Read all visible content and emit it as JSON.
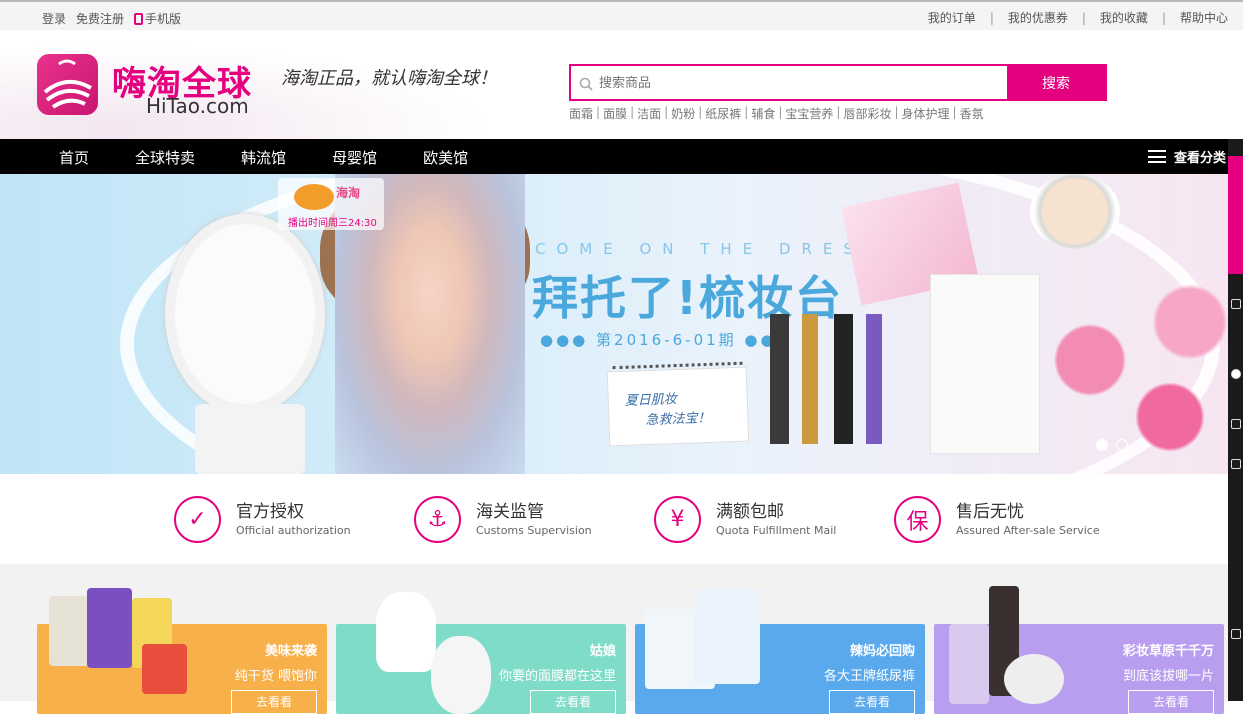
{
  "topbar": {
    "login": "登录",
    "register": "免费注册",
    "mobile": "手机版",
    "links": [
      "我的订单",
      "我的优惠券",
      "我的收藏",
      "帮助中心"
    ]
  },
  "header": {
    "logo_title": "嗨淘全球",
    "logo_sub": "HiTao.com",
    "slogan": "海淘正品，就认嗨淘全球！",
    "search_placeholder": "搜索商品",
    "search_button": "搜索",
    "hotwords": [
      "面霜",
      "面膜",
      "洁面",
      "奶粉",
      "纸尿裤",
      "辅食",
      "宝宝营养",
      "唇部彩妆",
      "身体护理",
      "香氛"
    ]
  },
  "nav": {
    "items": [
      "首页",
      "全球特卖",
      "韩流馆",
      "母婴馆",
      "欧美馆"
    ],
    "categories": "查看分类"
  },
  "banner": {
    "badge_time": "播出时间周三24:30",
    "badge_logo": "海淘",
    "en_title": "COME ON THE DRESSER",
    "title": "拜托了!梳妆台",
    "date": "●●● 第2016-6-01期 ●●●",
    "note_line1": "夏日肌妆",
    "note_line2": "急救法宝！"
  },
  "features": [
    {
      "icon": "shield-check-icon",
      "glyph": "✓",
      "title": "官方授权",
      "sub": "Official authorization"
    },
    {
      "icon": "anchor-icon",
      "glyph": "⚓",
      "title": "海关监管",
      "sub": "Customs Supervision"
    },
    {
      "icon": "yen-icon",
      "glyph": "¥",
      "title": "满额包邮",
      "sub": "Quota Fulfillment Mail"
    },
    {
      "icon": "bao-icon",
      "glyph": "保",
      "title": "售后无忧",
      "sub": "Assured After-sale Service"
    }
  ],
  "promos": [
    {
      "title": "美味来袭",
      "sub": "纯干货 喂饱你",
      "button": "去看看",
      "color": "#f7b04a"
    },
    {
      "title": "姑娘",
      "sub": "你要的面膜都在这里",
      "button": "去看看",
      "color": "#7fdcc9"
    },
    {
      "title": "辣妈必回购",
      "sub": "各大王牌纸尿裤",
      "button": "去看看",
      "color": "#5aa9ec"
    },
    {
      "title": "彩妆草原千千万",
      "sub": "到底该拔哪一片",
      "button": "去看看",
      "color": "#b99ef0"
    }
  ]
}
